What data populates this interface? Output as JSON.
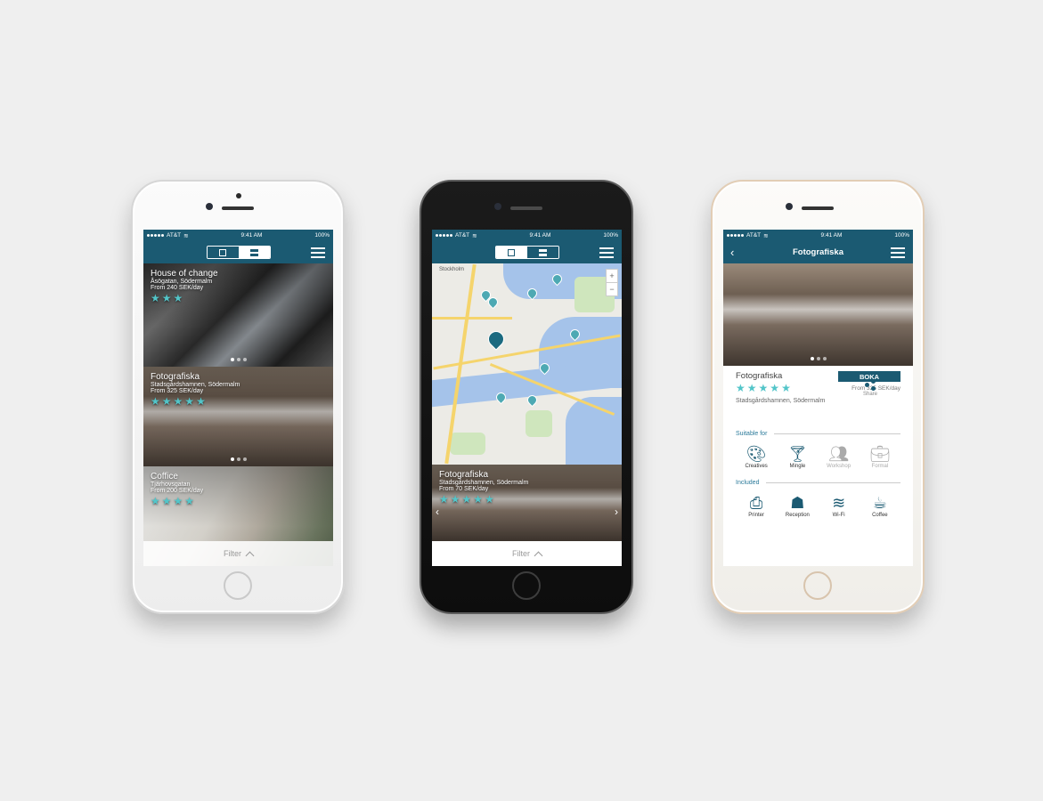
{
  "status": {
    "carrier": "AT&T",
    "time": "9:41 AM",
    "battery": "100%"
  },
  "colors": {
    "brand": "#1b5a72",
    "star": "#52c5c9"
  },
  "list_view": {
    "cards": [
      {
        "name": "House of change",
        "address": "Åsögatan, Södermalm",
        "price": "From 240 SEK/day",
        "stars": 3
      },
      {
        "name": "Fotografiska",
        "address": "Stadsgårdshamnen, Södermalm",
        "price": "From 325 SEK/day",
        "stars": 5
      },
      {
        "name": "Coffice",
        "address": "Tjärhovsgatan",
        "price": "From 200 SEK/day",
        "stars": 4
      }
    ],
    "filter_label": "Filter"
  },
  "map_view": {
    "map_labels": {
      "city": "Stockholm",
      "zoom_in": "+",
      "zoom_out": "−"
    },
    "card": {
      "name": "Fotografiska",
      "address": "Stadsgårdshamnen, Södermalm",
      "price": "From 70 SEK/day",
      "stars": 5
    },
    "filter_label": "Filter"
  },
  "detail_view": {
    "title": "Fotografiska",
    "back_icon": "chevron-left-icon",
    "name": "Fotografiska",
    "book_label": "BOKA",
    "price": "From 325 SEK/day",
    "stars": 5,
    "address": "Stadsgårdshamnen, Södermalm",
    "share_label": "Share",
    "suitable_label": "Suitable for",
    "suitable": [
      {
        "label": "Creatives",
        "icon": "palette-icon",
        "active": true
      },
      {
        "label": "Mingle",
        "icon": "cocktail-icon",
        "active": true
      },
      {
        "label": "Workshop",
        "icon": "people-icon",
        "active": false
      },
      {
        "label": "Formal",
        "icon": "briefcase-icon",
        "active": false
      }
    ],
    "included_label": "Included",
    "included": [
      {
        "label": "Printer",
        "icon": "printer-icon"
      },
      {
        "label": "Reception",
        "icon": "reception-icon"
      },
      {
        "label": "Wi-Fi",
        "icon": "wifi-icon"
      },
      {
        "label": "Coffee",
        "icon": "coffee-cup-icon"
      }
    ]
  }
}
